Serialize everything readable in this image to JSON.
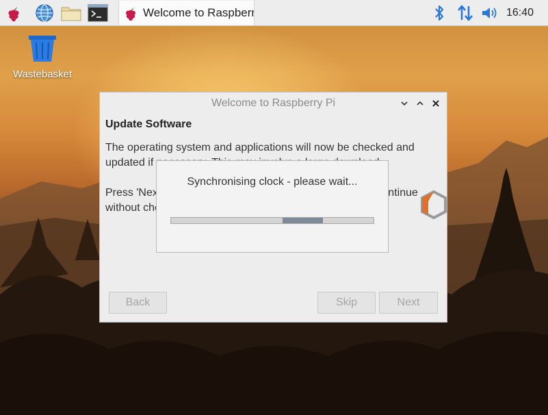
{
  "taskbar": {
    "icons": [
      "raspberry-menu-icon",
      "web-browser-icon",
      "file-manager-icon",
      "terminal-icon"
    ],
    "app_title": "Welcome to Raspberr…",
    "tray_icons": [
      "bluetooth-icon",
      "network-icon",
      "volume-icon"
    ],
    "clock": "16:40"
  },
  "desktop": {
    "wastebasket_label": "Wastebasket"
  },
  "main_window": {
    "title": "Welcome to Raspberry Pi",
    "heading": "Update Software",
    "paragraph1": "The operating system and applications will now be checked and updated if necessary. This may involve a large download.",
    "paragraph2": "Press 'Next' to check for and install updates, or 'Skip' to continue without checking.",
    "buttons": {
      "back": "Back",
      "skip": "Skip",
      "next": "Next"
    }
  },
  "sync_dialog": {
    "message": "Synchronising clock - please wait...",
    "progress_indicator": {
      "start": 0.55,
      "end": 0.75
    }
  },
  "colors": {
    "taskbar_bg": "#ededed",
    "window_bg": "#ededed",
    "bluetooth": "#2a78d8",
    "progress_fill": "#7d8a98"
  }
}
